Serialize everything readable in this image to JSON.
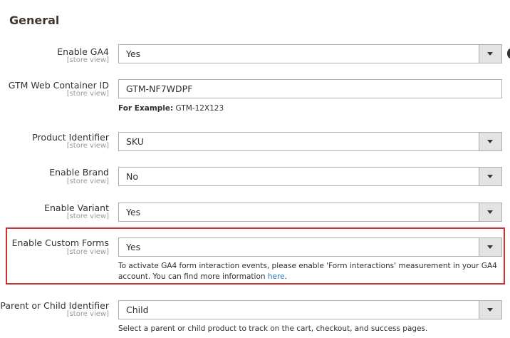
{
  "section": {
    "title": "General"
  },
  "fields": {
    "enable_ga4": {
      "label": "Enable GA4",
      "scope": "[store view]",
      "value": "Yes"
    },
    "gtm_container": {
      "label": "GTM Web Container ID",
      "scope": "[store view]",
      "value": "GTM-NF7WDPF",
      "example_prefix": "For Example:",
      "example_value": " GTM-12X123"
    },
    "product_identifier": {
      "label": "Product Identifier",
      "scope": "[store view]",
      "value": "SKU"
    },
    "enable_brand": {
      "label": "Enable Brand",
      "scope": "[store view]",
      "value": "No"
    },
    "enable_variant": {
      "label": "Enable Variant",
      "scope": "[store view]",
      "value": "Yes"
    },
    "enable_custom_forms": {
      "label": "Enable Custom Forms",
      "scope": "[store view]",
      "value": "Yes",
      "note_line1": "To activate GA4 form interaction events, please enable 'Form interactions' measurement in your GA4",
      "note_line2": "account. You can find more information ",
      "note_link": "here",
      "note_end": "."
    },
    "parent_child": {
      "label": "Parent or Child Identifier",
      "scope": "[store view]",
      "value": "Child",
      "note": "Select a parent or child product to track on the cart, checkout, and success pages."
    }
  },
  "colors": {
    "highlight_border": "#d22f2f",
    "link": "#1979c3"
  }
}
